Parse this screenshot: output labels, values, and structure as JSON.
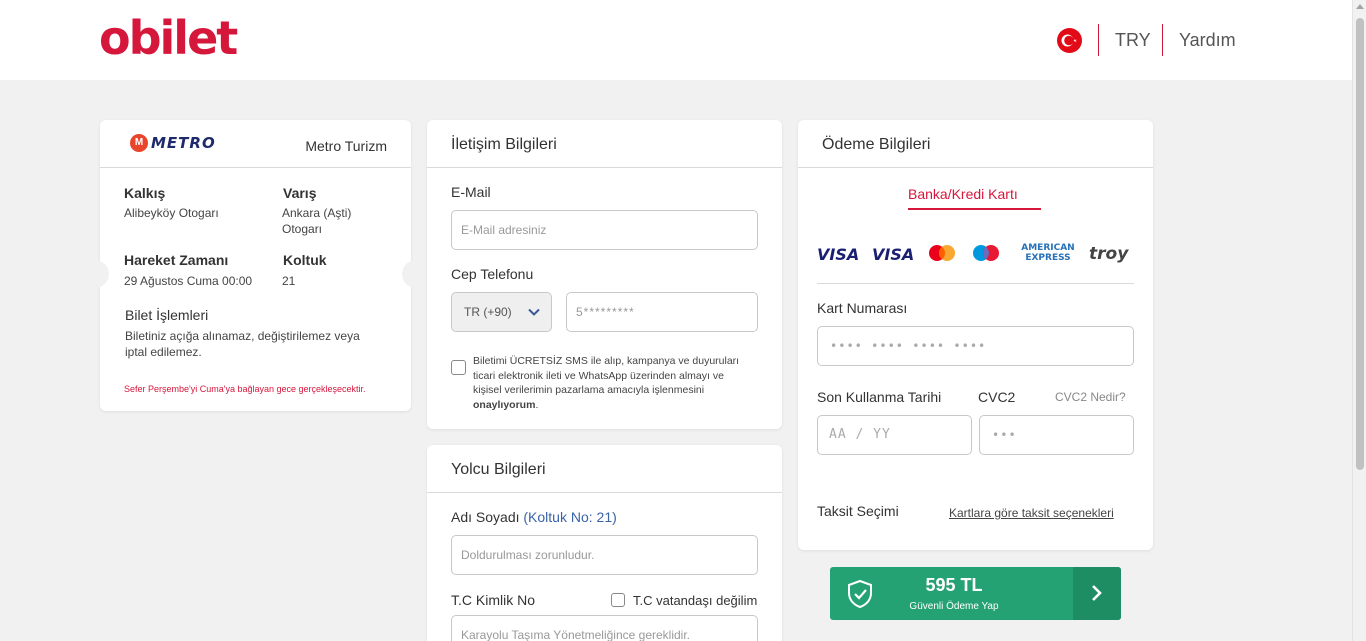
{
  "header": {
    "logo": "obilet",
    "currency": "TRY",
    "help": "Yardım",
    "flag_icon": "turkey-flag-icon"
  },
  "trip": {
    "operator_logo": "METRO",
    "company": "Metro Turizm",
    "departure_label": "Kalkış",
    "departure_value": "Alibeyköy Otogarı",
    "arrival_label": "Varış",
    "arrival_value_line1": "Ankara (Aşti)",
    "arrival_value_line2": "Otogarı",
    "time_label": "Hareket Zamanı",
    "time_value": "29 Ağustos Cuma 00:00",
    "seat_label": "Koltuk",
    "seat_value": "21",
    "ticket_ops_label": "Bilet İşlemleri",
    "ticket_ops_line1": "Biletiniz açığa alınamaz, değiştirilemez veya",
    "ticket_ops_line2": "iptal edilemez.",
    "warning": "Sefer Perşembe'yi Cuma'ya bağlayan gece gerçekleşecektir."
  },
  "contact": {
    "title": "İletişim Bilgileri",
    "email_label": "E-Mail",
    "email_placeholder": "E-Mail adresiniz",
    "phone_label": "Cep Telefonu",
    "phone_code": "TR (+90)",
    "phone_placeholder": "5*********",
    "consent_line1": "Biletimi ÜCRETSİZ SMS ile alıp, kampanya ve duyuruları",
    "consent_line2": "ticari elektronik ileti ve WhatsApp üzerinden almayı ve",
    "consent_line3": "kişisel verilerimin pazarlama amacıyla işlenmesini",
    "consent_bold": "onaylıyorum",
    "consent_end": "."
  },
  "passenger": {
    "title": "Yolcu Bilgileri",
    "name_label": "Adı Soyadı",
    "seat_note": "(Koltuk No: 21)",
    "name_placeholder": "Doldurulması zorunludur.",
    "tc_label": "T.C Kimlik No",
    "not_citizen_label": "T.C vatandaşı değilim",
    "tc_placeholder": "Karayolu Taşıma Yönetmeliğince gereklidir."
  },
  "payment": {
    "title": "Ödeme Bilgileri",
    "tab": "Banka/Kredi Kartı",
    "brands": [
      "VISA",
      "VISA",
      "mastercard",
      "maestro",
      "AMERICAN EXPRESS",
      "troy"
    ],
    "card_number_label": "Kart Numarası",
    "card_number_placeholder": "•••• •••• •••• ••••",
    "expiry_label": "Son Kullanma Tarihi",
    "expiry_placeholder": "AA / YY",
    "cvc_label": "CVC2",
    "cvc_help": "CVC2 Nedir?",
    "cvc_placeholder": "•••",
    "installment_label": "Taksit Seçimi",
    "installment_link": "Kartlara göre taksit seçenekleri"
  },
  "pay_button": {
    "amount": "595 TL",
    "subtitle": "Güvenli Ödeme Yap"
  },
  "colors": {
    "brand": "#d6173c",
    "pay_green": "#25a273",
    "seat_blue": "#3a63a8"
  }
}
